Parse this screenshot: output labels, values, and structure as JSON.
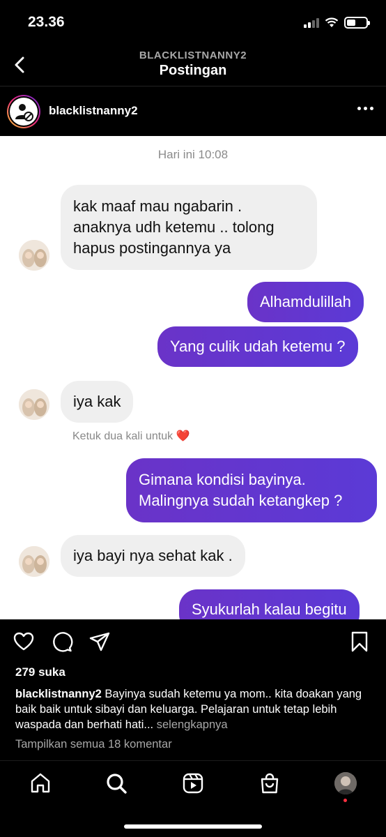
{
  "status_bar": {
    "time": "23.36"
  },
  "header": {
    "username": "BLACKLISTNANNY2",
    "title": "Postingan"
  },
  "post": {
    "username": "blacklistnanny2"
  },
  "chat": {
    "timestamp": "Hari ini 10:08",
    "messages": [
      {
        "side": "in",
        "text": "kak maaf mau ngabarin .\nanaknya udh ketemu  .. tolong\nhapus postingannya ya"
      },
      {
        "side": "out",
        "text": "Alhamdulillah"
      },
      {
        "side": "out",
        "text": "Yang culik udah ketemu ?"
      },
      {
        "side": "in",
        "text": "iya kak"
      },
      {
        "side": "out",
        "text": "Gimana kondisi bayinya.\nMalingnya sudah ketangkep ?"
      },
      {
        "side": "in",
        "text": "iya bayi nya sehat kak ."
      },
      {
        "side": "out",
        "text": "Syukurlah kalau begitu"
      }
    ],
    "reaction_hint": "Ketuk dua kali untuk",
    "reaction_emoji": "❤️"
  },
  "likes": "279 suka",
  "caption": {
    "username": "blacklistnanny2",
    "text": " Bayinya sudah ketemu ya mom.. kita doakan yang baik baik untuk sibayi dan keluarga. Pelajaran untuk tetap lebih waspada dan berhati hati...",
    "more": " selengkapnya"
  },
  "comments_link": "Tampilkan semua 18 komentar",
  "icons": {
    "back": "chevron-left-icon",
    "like": "heart-icon",
    "comment": "comment-icon",
    "share": "send-icon",
    "save": "bookmark-icon",
    "home": "home-icon",
    "search": "search-icon",
    "reels": "reels-icon",
    "shop": "shop-icon"
  },
  "colors": {
    "outgoing_bubble": "#5b3ad6",
    "incoming_bubble": "#efefef",
    "notification_dot": "#ff3040"
  }
}
